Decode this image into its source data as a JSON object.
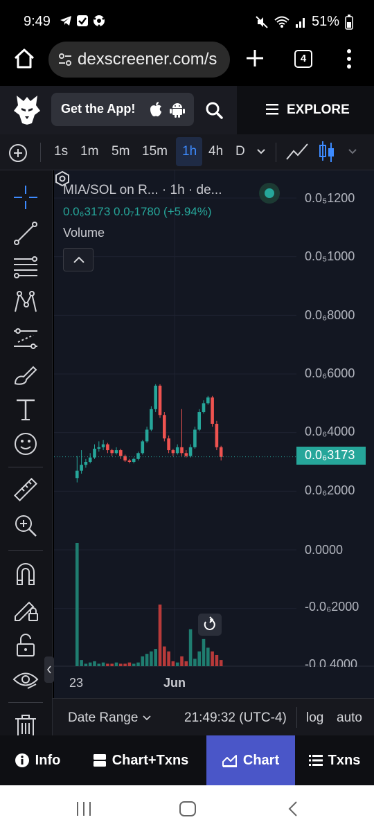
{
  "status_bar": {
    "time": "9:49",
    "battery": "51%",
    "icons": [
      "telegram-icon",
      "check-box-icon",
      "soccer-icon",
      "mute-icon",
      "wifi-icon",
      "signal-icon",
      "battery-icon"
    ]
  },
  "browser": {
    "url": "dexscreener.com/s",
    "tab_count": "4"
  },
  "site_header": {
    "get_app_label": "Get the App!",
    "explore_label": "EXPLORE"
  },
  "timeframes": {
    "items": [
      "1s",
      "1m",
      "5m",
      "15m",
      "1h",
      "4h",
      "D"
    ],
    "active": "1h"
  },
  "chart_legend": {
    "title": "MIA/SOL on R... · 1h · de...",
    "price_values": "0.0₆3173  0.0₇1780 (+5.94%)",
    "volume_label": "Volume"
  },
  "price_axis": {
    "labels": [
      "0.0₅1200",
      "0.0₅1000",
      "0.0₆8000",
      "0.0₆6000",
      "0.0₆4000",
      "0.0₆2000",
      "0.0000",
      "-0.0₆2000",
      "-0.0.4000"
    ],
    "current_price_tag": "0.0₆3173"
  },
  "time_axis": {
    "labels": [
      "23",
      "Jun"
    ]
  },
  "date_bar": {
    "date_range_label": "Date Range",
    "clock": "21:49:32 (UTC-4)",
    "log_label": "log",
    "auto_label": "auto"
  },
  "app_tabs": [
    {
      "label": "Info",
      "icon": "info-icon"
    },
    {
      "label": "Chart+Txns",
      "icon": "split-icon"
    },
    {
      "label": "Chart",
      "icon": "chart-icon"
    },
    {
      "label": "Txns",
      "icon": "list-icon"
    }
  ],
  "active_tab": "Chart",
  "colors": {
    "up": "#26a69a",
    "down": "#ef5350",
    "accent": "#4a56c8",
    "chart_bg": "#131722"
  },
  "chart_data": {
    "type": "candlestick",
    "series_unit": "price (SOL), scale 1e-5",
    "ylim": [
      -0.4,
      1.3
    ],
    "x_labels": [
      "23",
      "Jun"
    ],
    "candles": [
      [
        0.245,
        0.27,
        0.32,
        0.23
      ],
      [
        0.27,
        0.29,
        0.34,
        0.26
      ],
      [
        0.29,
        0.3,
        0.31,
        0.28
      ],
      [
        0.3,
        0.315,
        0.33,
        0.295
      ],
      [
        0.315,
        0.345,
        0.36,
        0.31
      ],
      [
        0.345,
        0.35,
        0.37,
        0.335
      ],
      [
        0.35,
        0.36,
        0.375,
        0.34
      ],
      [
        0.36,
        0.34,
        0.365,
        0.33
      ],
      [
        0.34,
        0.33,
        0.345,
        0.32
      ],
      [
        0.33,
        0.34,
        0.35,
        0.325
      ],
      [
        0.34,
        0.32,
        0.345,
        0.31
      ],
      [
        0.32,
        0.305,
        0.325,
        0.3
      ],
      [
        0.305,
        0.3,
        0.31,
        0.295
      ],
      [
        0.3,
        0.31,
        0.315,
        0.295
      ],
      [
        0.31,
        0.33,
        0.335,
        0.305
      ],
      [
        0.33,
        0.37,
        0.375,
        0.325
      ],
      [
        0.37,
        0.41,
        0.42,
        0.365
      ],
      [
        0.41,
        0.48,
        0.49,
        0.405
      ],
      [
        0.48,
        0.56,
        0.565,
        0.47
      ],
      [
        0.56,
        0.46,
        0.565,
        0.45
      ],
      [
        0.46,
        0.38,
        0.47,
        0.37
      ],
      [
        0.38,
        0.34,
        0.39,
        0.33
      ],
      [
        0.34,
        0.33,
        0.345,
        0.32
      ],
      [
        0.33,
        0.35,
        0.36,
        0.325
      ],
      [
        0.35,
        0.33,
        0.48,
        0.32
      ],
      [
        0.33,
        0.32,
        0.34,
        0.315
      ],
      [
        0.32,
        0.35,
        0.36,
        0.315
      ],
      [
        0.35,
        0.41,
        0.42,
        0.345
      ],
      [
        0.41,
        0.47,
        0.48,
        0.405
      ],
      [
        0.47,
        0.5,
        0.51,
        0.465
      ],
      [
        0.5,
        0.52,
        0.525,
        0.495
      ],
      [
        0.52,
        0.43,
        0.525,
        0.42
      ],
      [
        0.43,
        0.35,
        0.44,
        0.34
      ],
      [
        0.35,
        0.317,
        0.355,
        0.305
      ]
    ],
    "volumes": [
      1.0,
      0.05,
      0.02,
      0.03,
      0.04,
      0.02,
      0.03,
      0.02,
      0.02,
      0.03,
      0.02,
      0.02,
      0.03,
      0.02,
      0.03,
      0.08,
      0.1,
      0.12,
      0.14,
      0.5,
      0.16,
      0.12,
      0.04,
      0.03,
      0.08,
      0.04,
      0.3,
      0.06,
      0.12,
      0.22,
      0.15,
      0.12,
      0.09,
      0.05
    ],
    "last_price": 0.3173
  }
}
